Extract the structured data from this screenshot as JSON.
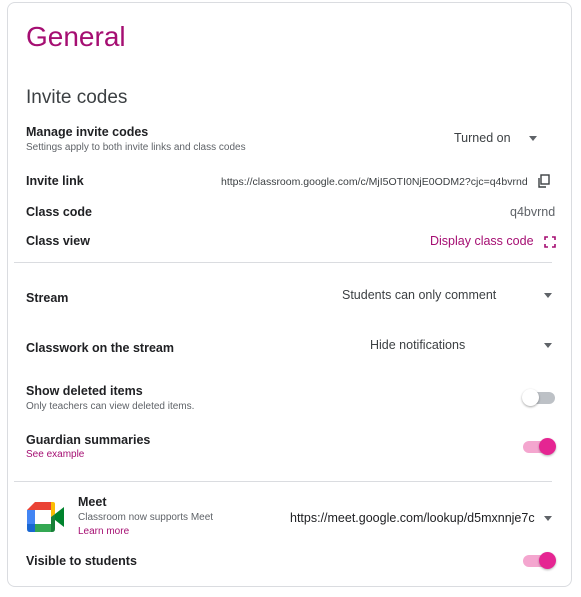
{
  "header": {
    "title": "General"
  },
  "invite": {
    "section_title": "Invite codes",
    "manage_label": "Manage invite codes",
    "manage_sub": "Settings apply to both invite links and class codes",
    "manage_value": "Turned on",
    "link_label": "Invite link",
    "link_value": "https://classroom.google.com/c/MjI5OTI0NjE0ODM2?cjc=q4bvrnd",
    "code_label": "Class code",
    "code_value": "q4bvrnd",
    "view_label": "Class view",
    "view_action": "Display class code"
  },
  "stream": {
    "label": "Stream",
    "value": "Students can only comment"
  },
  "classwork": {
    "label": "Classwork on the stream",
    "value": "Hide notifications"
  },
  "deleted": {
    "label": "Show deleted items",
    "sub": "Only teachers can view deleted items.",
    "enabled": false
  },
  "guardian": {
    "label": "Guardian summaries",
    "link": "See example",
    "enabled": true
  },
  "meet": {
    "label": "Meet",
    "sub": "Classroom now supports Meet",
    "learn_more": "Learn more",
    "url": "https://meet.google.com/lookup/d5mxnnje7c",
    "visible_label": "Visible to students",
    "visible_enabled": true
  },
  "colors": {
    "accent": "#a50e72",
    "toggle_on_thumb": "#e52592",
    "toggle_on_track": "#f4a6cf",
    "toggle_off_thumb": "#ffffff",
    "toggle_off_track": "#bdc1c6"
  },
  "icons": {
    "copy": "copy-icon",
    "fullscreen": "fullscreen-icon",
    "meet_logo": "google-meet-logo"
  }
}
